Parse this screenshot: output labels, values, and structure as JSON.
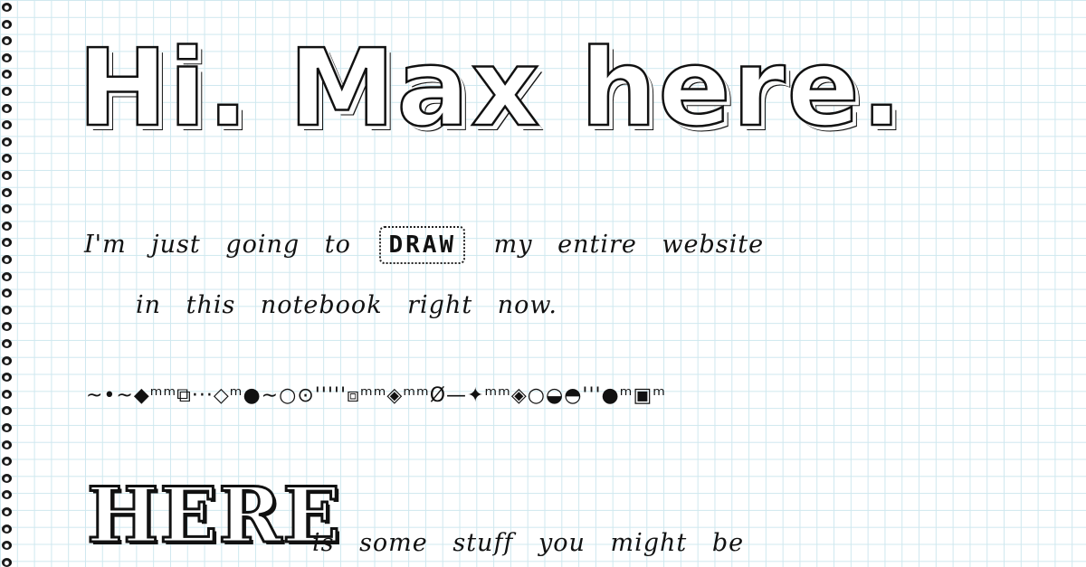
{
  "page": {
    "title": "Hi. Max here.",
    "intro_line1_before": "I'm just going to",
    "intro_emphasis": "DRAW",
    "intro_line1_after": "my entire website",
    "intro_line2": "in this notebook right now.",
    "divider_doodle": "~•~◆ᵐᵐ⧉···◇ᵐ●∼○⊙'''''⧈ᵐᵐ◈ᵐᵐØ—✦ᵐᵐ◈○◒◓'''●ᵐ▣ᵐ",
    "here_heading": "HERE",
    "here_line": "is some stuff you might be"
  },
  "style": {
    "ink": "#111111",
    "grid": "#cfe8ef",
    "paper": "#ffffff"
  },
  "icons": {
    "spiral_binding": "spiral-ring-icon"
  }
}
